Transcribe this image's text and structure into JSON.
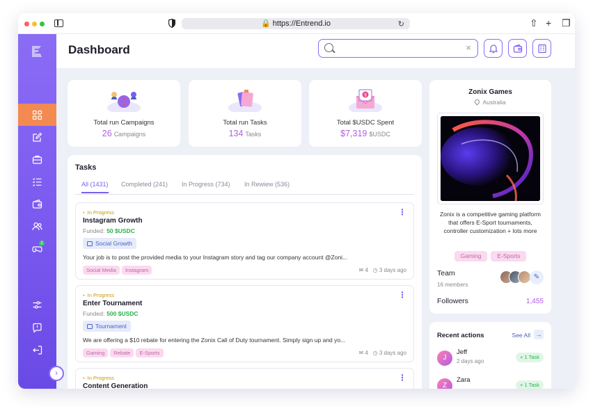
{
  "browser": {
    "url": "https://Entrend.io"
  },
  "header": {
    "title": "Dashboard",
    "search_placeholder": ""
  },
  "stats": [
    {
      "label": "Total run Campaigns",
      "value": "26",
      "unit": "Campaigns"
    },
    {
      "label": "Total run Tasks",
      "value": "134",
      "unit": "Tasks"
    },
    {
      "label": "Total $USDC Spent",
      "value": "$7,319",
      "unit": "$USDC"
    }
  ],
  "tasks": {
    "title": "Tasks",
    "tabs": [
      {
        "label": "All (1431)",
        "active": true
      },
      {
        "label": "Completed (241)",
        "active": false
      },
      {
        "label": "In Progress (734)",
        "active": false
      },
      {
        "label": "In Rewiew (536)",
        "active": false
      }
    ],
    "funded_label": "Funded:",
    "items": [
      {
        "status": "In Progress",
        "title": "Instagram Growth",
        "funded": "50 $USDC",
        "type": "Social Growth",
        "description": "Your job is to post the provided media to your Instagram story and tag our company account @Zoni...",
        "tags": [
          "Social Media",
          "Instagram"
        ],
        "comments": "4",
        "time": "3 days ago"
      },
      {
        "status": "In Progress",
        "title": "Enter Tournament",
        "funded": "500 $USDC",
        "type": "Tournament",
        "description": "We are offering a $10 rebate for entering the Zonix Call of Duty tournament. Simply sign up and yo...",
        "tags": [
          "Gaming",
          "Rebate",
          "E-Sports"
        ],
        "comments": "4",
        "time": "3 days ago"
      },
      {
        "status": "In Progress",
        "title": "Content Generation",
        "funded": "",
        "type": "",
        "description": "",
        "tags": [],
        "comments": "",
        "time": ""
      }
    ]
  },
  "company": {
    "name": "Zonix Games",
    "location": "Australia",
    "description": "Zonix is a competitive gaming platform that offers E-Sport tournaments, controller customization + lots more",
    "tags": [
      "Gaming",
      "E-Sports"
    ],
    "team_label": "Team",
    "team_count": "16 members",
    "followers_label": "Followers",
    "followers_count": "1,455"
  },
  "recent": {
    "title": "Recent actions",
    "see_all": "See All",
    "items": [
      {
        "initial": "J",
        "name": "Jeff",
        "time": "2 days ago",
        "action": "+ 1 Task"
      },
      {
        "initial": "Z",
        "name": "Zara",
        "time": "",
        "action": "+ 1 Task"
      }
    ]
  },
  "sidebar": {
    "items": [
      {
        "icon": "grid-icon",
        "active": true
      },
      {
        "icon": "edit-icon",
        "active": false
      },
      {
        "icon": "briefcase-icon",
        "active": false
      },
      {
        "icon": "checklist-icon",
        "active": false
      },
      {
        "icon": "wallet-icon",
        "active": false
      },
      {
        "icon": "users-icon",
        "active": false
      },
      {
        "icon": "gamepad-icon",
        "active": false,
        "badge": "2"
      },
      {
        "icon": "settings-sliders-icon",
        "active": false
      },
      {
        "icon": "feedback-icon",
        "active": false
      },
      {
        "icon": "logout-icon",
        "active": false
      }
    ]
  },
  "colors": {
    "accent": "#7d5cf0",
    "sidebar_active": "#f28a52",
    "highlight_value": "#b15ee0",
    "funded_green": "#2bb24c",
    "status_amber": "#c79a00"
  }
}
